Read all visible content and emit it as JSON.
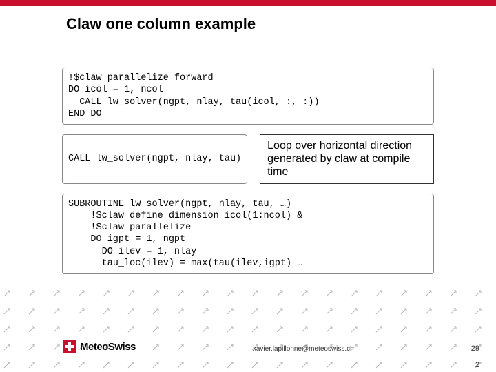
{
  "title": "Claw one column example",
  "code1": "!$claw parallelize forward\nDO icol = 1, ncol\n  CALL lw_solver(ngpt, nlay, tau(icol, :, :))\nEND DO",
  "code2": "CALL lw_solver(ngpt, nlay, tau)",
  "annotation": "Loop over horizontal direction generated by claw at compile time",
  "code3": "SUBROUTINE lw_solver(ngpt, nlay, tau, …)\n    !$claw define dimension icol(1:ncol) &\n    !$claw parallelize\n    DO igpt = 1, ngpt\n      DO ilev = 1, nlay\n      tau_loc(ilev) = max(tau(ilev,igpt) …",
  "logo": "MeteoSwiss",
  "email": "xavier.lapillonne@meteoswiss.ch",
  "page": "29",
  "page2": "2"
}
